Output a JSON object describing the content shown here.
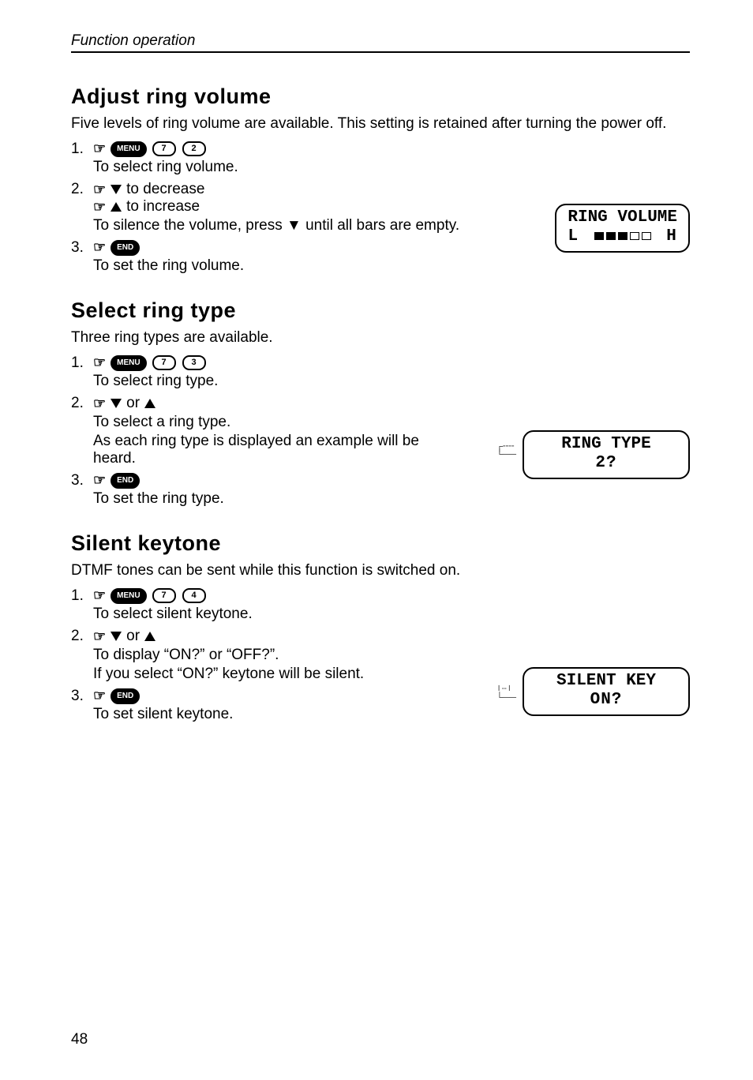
{
  "header": {
    "running": "Function operation"
  },
  "sections": {
    "ring_volume": {
      "title": "Adjust ring volume",
      "intro": "Five levels of ring volume are available. This setting is retained after turning the power off.",
      "step1": "To select ring volume.",
      "step2a_suffix": "to decrease",
      "step2b_suffix": "to increase",
      "step2_note": "To silence the volume, press ▼ until all bars are empty.",
      "step3": "To set the ring volume.",
      "lcd_line1": "RING VOLUME",
      "lcd_L": "L",
      "lcd_H": "H"
    },
    "ring_type": {
      "title": "Select ring type",
      "intro": "Three ring types are available.",
      "step1": "To select ring type.",
      "or": "or",
      "step2a": "To select a ring type.",
      "step2b": "As each ring type is displayed an example will be heard.",
      "step3": "To set the ring type.",
      "lcd_line1": "RING TYPE",
      "lcd_line2": "2?"
    },
    "silent_key": {
      "title": "Silent keytone",
      "intro": "DTMF tones can be sent while this function is switched on.",
      "step1": "To select silent keytone.",
      "or": "or",
      "step2a": "To display “ON?” or “OFF?”.",
      "step2b": "If you select “ON?” keytone will be silent.",
      "step3": "To set silent keytone.",
      "lcd_line1": "SILENT KEY",
      "lcd_line2": "ON?"
    }
  },
  "keys": {
    "menu": "MENU",
    "end": "END",
    "two": "2",
    "three": "3",
    "four": "4",
    "seven": "7"
  },
  "page_number": "48"
}
